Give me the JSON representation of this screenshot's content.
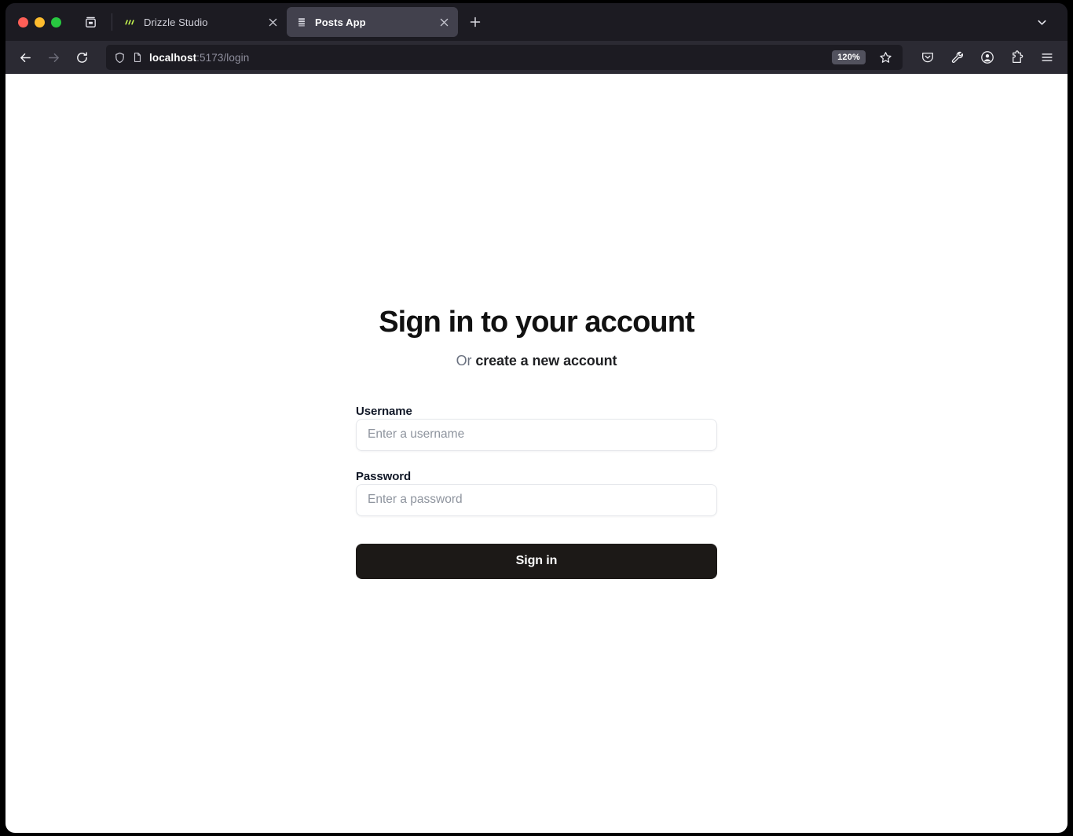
{
  "window": {
    "traffic_lights": [
      "close",
      "minimize",
      "maximize"
    ],
    "firefox_view_label": "Firefox View"
  },
  "tabs": [
    {
      "title": "Drizzle Studio",
      "favicon": "drizzle-slashes-icon",
      "active": false,
      "close_label": "Close tab"
    },
    {
      "title": "Posts App",
      "favicon": "document-lines-icon",
      "active": true,
      "close_label": "Close tab"
    }
  ],
  "tab_bar": {
    "new_tab_label": "+",
    "list_all_tabs_icon": "chevron-down-icon"
  },
  "toolbar": {
    "back_icon": "back-arrow-icon",
    "forward_icon": "forward-arrow-icon",
    "reload_icon": "reload-icon",
    "shield_icon": "shield-icon",
    "page_icon": "page-document-icon",
    "url_host": "localhost",
    "url_rest": ":5173/login",
    "zoom_level": "120%",
    "bookmark_icon": "star-icon",
    "right_icons": [
      {
        "name": "pocket-icon"
      },
      {
        "name": "wrench-icon"
      },
      {
        "name": "account-circle-icon"
      },
      {
        "name": "extensions-puzzle-icon"
      },
      {
        "name": "hamburger-menu-icon"
      }
    ]
  },
  "page": {
    "title": "Sign in to your account",
    "subtitle_prefix": "Or ",
    "subtitle_link": "create a new account",
    "fields": [
      {
        "label": "Username",
        "placeholder": "Enter a username",
        "value": "",
        "type": "text"
      },
      {
        "label": "Password",
        "placeholder": "Enter a password",
        "value": "",
        "type": "password"
      }
    ],
    "submit_label": "Sign in"
  },
  "colors": {
    "tab_bar_bg": "#1c1b22",
    "active_tab_bg": "#42414d",
    "nav_toolbar_bg": "#2b2a33",
    "url_field_bg": "#1c1b22",
    "page_bg": "#ffffff",
    "button_bg": "#1c1917",
    "input_border": "#e5e7eb",
    "muted_text": "#6b7280",
    "drizzle_accent": "#c5f74f"
  }
}
